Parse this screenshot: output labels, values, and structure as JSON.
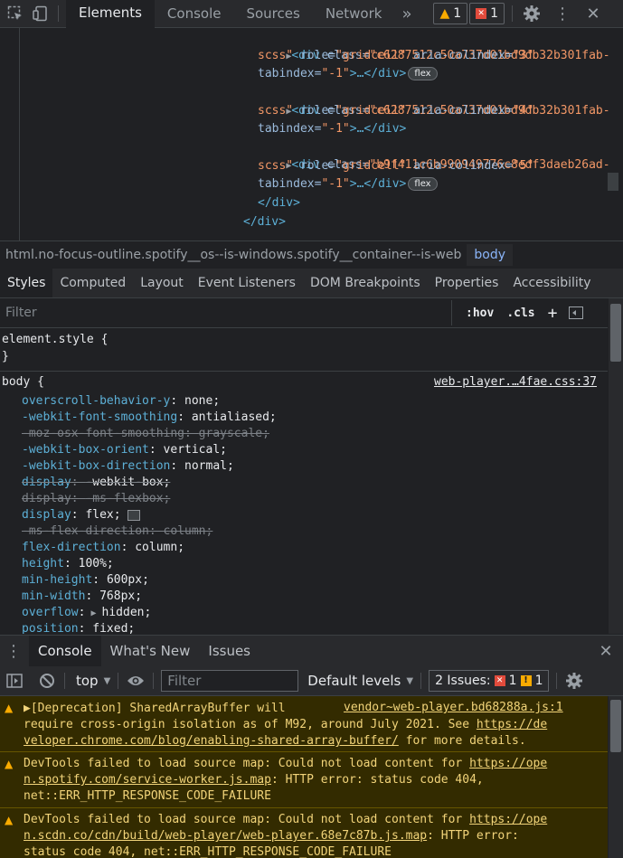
{
  "toolbar": {
    "tabs": [
      "Elements",
      "Console",
      "Sources",
      "Network"
    ],
    "more": "»",
    "warnings": "1",
    "errors": "1"
  },
  "elements": {
    "lines": [
      {
        "tri": "▶",
        "open": "<div ",
        "a1": "class=",
        "v1": "\"c6287512c50a737d01bd9db32b301fab-",
        "rest": ""
      },
      {
        "cont": "scss\"",
        "a2": " role=",
        "v2": "\"gridcell\"",
        "a3": " aria-colindex=",
        "v3": "\"3\""
      },
      {
        "a4": "tabindex=",
        "v4": "\"-1\"",
        "tail": ">…</div>",
        "badge": "flex"
      },
      {
        "tri": "▶",
        "open": "<div ",
        "a1": "class=",
        "v1": "\"c6287512c50a737d01bd9db32b301fab-"
      },
      {
        "cont": "scss\"",
        "a2": " role=",
        "v2": "\"gridcell\"",
        "a3": " aria-colindex=",
        "v3": "\"4\""
      },
      {
        "a4": "tabindex=",
        "v4": "\"-1\"",
        "tail": ">…</div>"
      },
      {
        "tri": "▶",
        "open": "<div ",
        "a1": "class=",
        "v1": "\"b9f411c6b990949776c8edf3daeb26ad-"
      },
      {
        "cont": "scss\"",
        "a2": " role=",
        "v2": "\"gridcell\"",
        "a3": " aria-colindex=",
        "v3": "\"5\""
      },
      {
        "a4": "tabindex=",
        "v4": "\"-1\"",
        "tail": ">…</div>",
        "badge": "flex"
      },
      {
        "close": "</div>"
      },
      {
        "close": "</div>"
      }
    ]
  },
  "breadcrumb": {
    "html": "html.no-focus-outline.spotify__os--is-windows.spotify__container--is-web",
    "body": "body"
  },
  "styles_tabs": [
    "Styles",
    "Computed",
    "Layout",
    "Event Listeners",
    "DOM Breakpoints",
    "Properties",
    "Accessibility"
  ],
  "styles_filter": {
    "placeholder": "Filter",
    "hov": ":hov",
    "cls": ".cls",
    "plus": "+"
  },
  "styles": {
    "element_style": "element.style {",
    "element_close": "}",
    "body_selector": "body {",
    "source": "web-player.…4fae.css:37",
    "props": [
      {
        "name": "overscroll-behavior-y",
        "value": "none;",
        "struck": false
      },
      {
        "name": "-webkit-font-smoothing",
        "value": "antialiased;",
        "struck": false
      },
      {
        "name": "-moz-osx-font-smoothing",
        "value": "grayscale;",
        "struck": true
      },
      {
        "name": "-webkit-box-orient",
        "value": "vertical;",
        "struck": false
      },
      {
        "name": "-webkit-box-direction",
        "value": "normal;",
        "struck": false
      },
      {
        "name": "display",
        "value": "-webkit-box;",
        "struck": true
      },
      {
        "name": "display",
        "value": "-ms-flexbox;",
        "struck": true
      },
      {
        "name": "display",
        "value": "flex;",
        "struck": false,
        "flexicon": true
      },
      {
        "name": "-ms-flex-direction",
        "value": "column;",
        "struck": true
      },
      {
        "name": "flex-direction",
        "value": "column;",
        "struck": false
      },
      {
        "name": "height",
        "value": "100%;",
        "struck": false
      },
      {
        "name": "min-height",
        "value": "600px;",
        "struck": false
      },
      {
        "name": "min-width",
        "value": "768px;",
        "struck": false
      },
      {
        "name": "overflow",
        "value": "hidden;",
        "struck": false,
        "expander": true
      },
      {
        "name": "position",
        "value": "fixed;",
        "struck": false
      }
    ]
  },
  "drawer": {
    "tabs": [
      "Console",
      "What's New",
      "Issues"
    ],
    "context": "top",
    "filter_placeholder": "Filter",
    "levels": "Default levels",
    "issues_label": "2 Issues:",
    "issues_errors": "1",
    "issues_warnings": "1"
  },
  "messages": [
    {
      "lines": [
        "▶[Deprecation] SharedArrayBuffer will",
        "require cross-origin isolation as of M92, around July 2021. See ",
        "veloper.chrome.com/blog/enabling-shared-array-buffer/"
      ],
      "source": "vendor~web-player.bd68288a.js:1",
      "link_part1": "https://de",
      "tail": " for more details."
    },
    {
      "lines": [
        "DevTools failed to load source map: Could not load content for ",
        "n.spotify.com/service-worker.js.map",
        "net::ERR_HTTP_RESPONSE_CODE_FAILURE"
      ],
      "link_part1": "https://ope",
      "tail": ": HTTP error: status code 404,"
    },
    {
      "lines": [
        "DevTools failed to load source map: Could not load content for ",
        "n.scdn.co/cdn/build/web-player/web-player.68e7c87b.js.map",
        "status code 404, net::ERR_HTTP_RESPONSE_CODE_FAILURE"
      ],
      "link_part1": "https://ope",
      "tail": ": HTTP error:"
    }
  ]
}
